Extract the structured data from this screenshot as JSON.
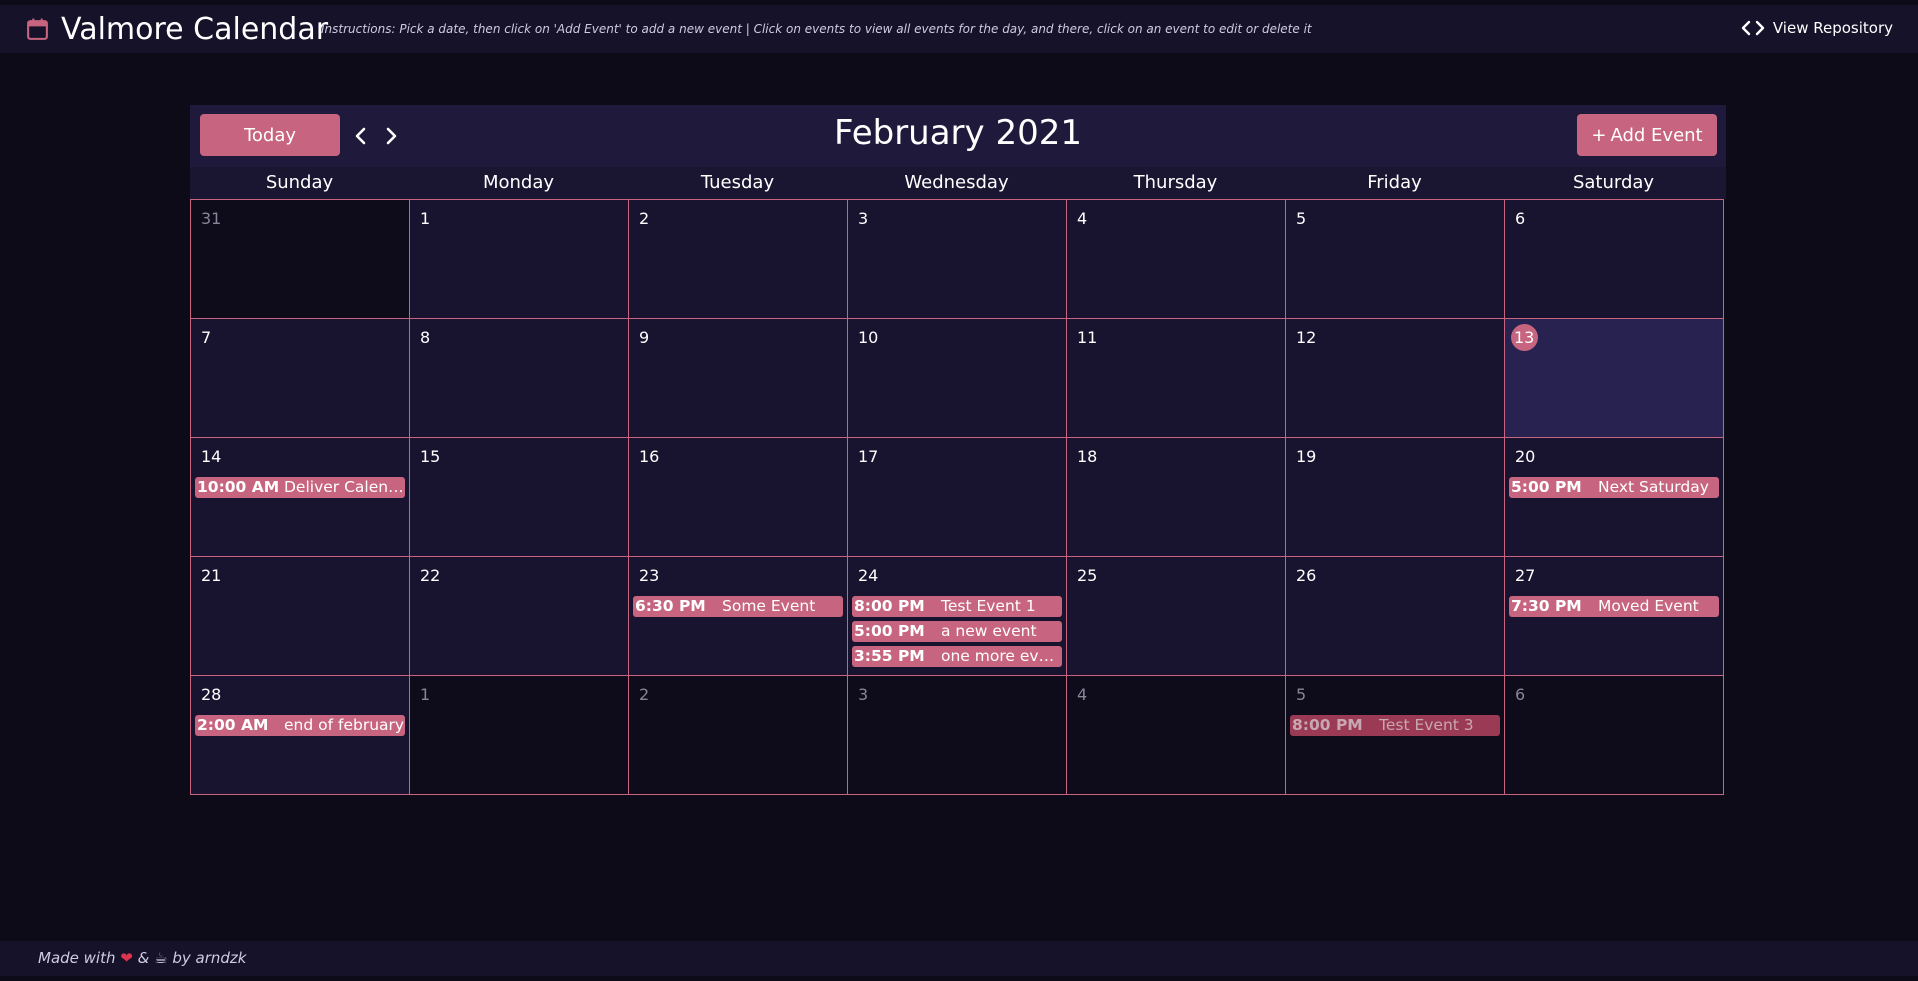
{
  "header": {
    "title": "Valmore Calendar",
    "instructions": "Instructions: Pick a date, then click on 'Add Event' to add a new event | Click on events to view all events for the day, and there, click on an event to edit or delete it",
    "repo_label": "View Repository"
  },
  "toolbar": {
    "today_label": "Today",
    "month_title": "February 2021",
    "add_label": "Add Event"
  },
  "weekdays": [
    "Sunday",
    "Monday",
    "Tuesday",
    "Wednesday",
    "Thursday",
    "Friday",
    "Saturday"
  ],
  "days": [
    {
      "n": "31",
      "other": true,
      "events": []
    },
    {
      "n": "1",
      "events": []
    },
    {
      "n": "2",
      "events": []
    },
    {
      "n": "3",
      "events": []
    },
    {
      "n": "4",
      "events": []
    },
    {
      "n": "5",
      "events": []
    },
    {
      "n": "6",
      "events": []
    },
    {
      "n": "7",
      "events": []
    },
    {
      "n": "8",
      "events": []
    },
    {
      "n": "9",
      "events": []
    },
    {
      "n": "10",
      "events": []
    },
    {
      "n": "11",
      "events": []
    },
    {
      "n": "12",
      "events": []
    },
    {
      "n": "13",
      "today": true,
      "events": []
    },
    {
      "n": "14",
      "events": [
        {
          "time": "10:00 AM",
          "title": "Deliver Calendar"
        }
      ]
    },
    {
      "n": "15",
      "events": []
    },
    {
      "n": "16",
      "events": []
    },
    {
      "n": "17",
      "events": []
    },
    {
      "n": "18",
      "events": []
    },
    {
      "n": "19",
      "events": []
    },
    {
      "n": "20",
      "events": [
        {
          "time": "5:00 PM",
          "title": "Next Saturday"
        }
      ]
    },
    {
      "n": "21",
      "events": []
    },
    {
      "n": "22",
      "events": []
    },
    {
      "n": "23",
      "events": [
        {
          "time": "6:30 PM",
          "title": "Some Event"
        }
      ]
    },
    {
      "n": "24",
      "events": [
        {
          "time": "8:00 PM",
          "title": "Test Event 1"
        },
        {
          "time": "5:00 PM",
          "title": "a new event"
        },
        {
          "time": "3:55 PM",
          "title": "one more event"
        }
      ]
    },
    {
      "n": "25",
      "events": []
    },
    {
      "n": "26",
      "events": []
    },
    {
      "n": "27",
      "events": [
        {
          "time": "7:30 PM",
          "title": "Moved Event"
        }
      ]
    },
    {
      "n": "28",
      "events": [
        {
          "time": "2:00 AM",
          "title": "end of february"
        }
      ]
    },
    {
      "n": "1",
      "other": true,
      "events": []
    },
    {
      "n": "2",
      "other": true,
      "events": []
    },
    {
      "n": "3",
      "other": true,
      "events": []
    },
    {
      "n": "4",
      "other": true,
      "events": []
    },
    {
      "n": "5",
      "other": true,
      "events": [
        {
          "time": "8:00 PM",
          "title": "Test Event 3",
          "past": true
        }
      ]
    },
    {
      "n": "6",
      "other": true,
      "events": []
    }
  ],
  "footer": {
    "made_with": "Made with",
    "and": "&",
    "by": "by arndzk"
  },
  "icons": {
    "header": "calendar-icon",
    "repo": "code-icon",
    "prev": "chevron-left-icon",
    "next": "chevron-right-icon",
    "add": "plus-icon"
  },
  "colors": {
    "accent": "#c7647f",
    "background": "#0d0b18",
    "panel": "#15122a",
    "cell": "#181430",
    "today_cell": "#272250"
  }
}
